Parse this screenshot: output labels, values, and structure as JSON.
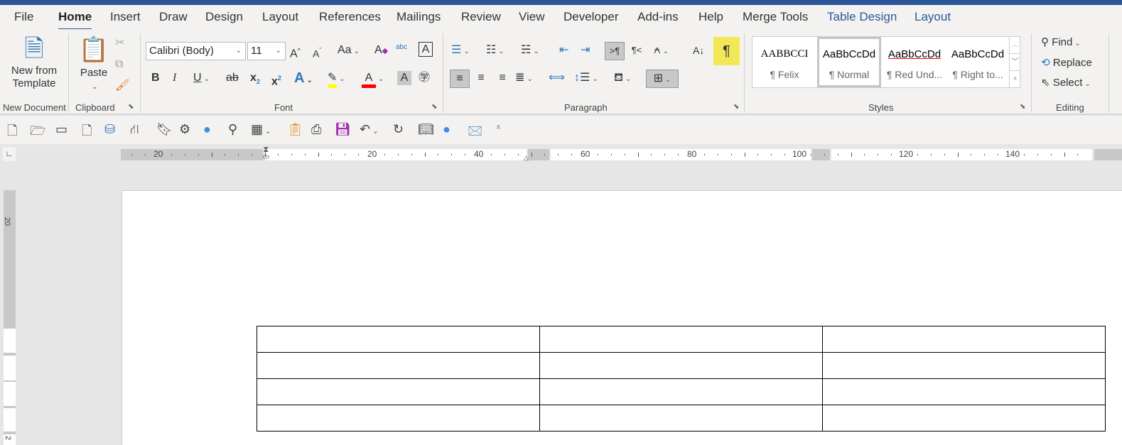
{
  "tabs": [
    "File",
    "Home",
    "Insert",
    "Draw",
    "Design",
    "Layout",
    "References",
    "Mailings",
    "Review",
    "View",
    "Developer",
    "Add-ins",
    "Help",
    "Merge Tools",
    "Table Design",
    "Layout"
  ],
  "active_tab": "Home",
  "ribbon": {
    "new_document": {
      "button": "New from",
      "button2": "Template",
      "label": "New Document"
    },
    "clipboard": {
      "paste": "Paste",
      "label": "Clipboard"
    },
    "font": {
      "font_name": "Calibri (Body)",
      "font_size": "11",
      "label": "Font",
      "change_case": "Aa",
      "text_effects": "A",
      "font_color": "A",
      "shading": "A",
      "bold": "B",
      "italic": "I",
      "underline": "U",
      "strike": "ab",
      "grow": "A",
      "shrink": "A",
      "clear": "A",
      "phonetic": "abc",
      "border": "A",
      "highlight_color": "#ffff00",
      "font_color_value": "#ff0000"
    },
    "paragraph": {
      "label": "Paragraph",
      "show_marks": "¶",
      "ltr": ">¶",
      "rtl": "¶<"
    },
    "styles": {
      "label": "Styles",
      "items": [
        {
          "preview": "AABBCCI",
          "name": "¶ Felix"
        },
        {
          "preview": "AaBbCcDd",
          "name": "¶ Normal"
        },
        {
          "preview": "AaBbCcDd",
          "name": "¶ Red Und..."
        },
        {
          "preview": "AaBbCcDd",
          "name": "¶ Right to..."
        }
      ]
    },
    "editing": {
      "label": "Editing",
      "find": "Find",
      "replace": "Replace",
      "select": "Select"
    }
  },
  "ruler": {
    "labels": [
      "20",
      "20",
      "40",
      "60",
      "80",
      "100",
      "120",
      "140"
    ],
    "vertical_labels": [
      "20",
      "2"
    ]
  },
  "table": {
    "rows": 4,
    "cols": 3
  }
}
